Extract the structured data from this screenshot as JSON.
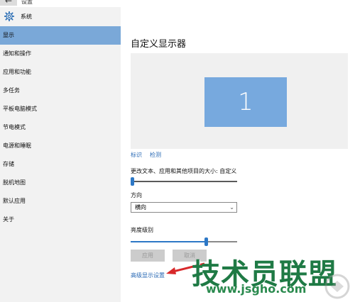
{
  "window": {
    "title": "设置",
    "back_glyph": "←"
  },
  "sidebar": {
    "header": "系统",
    "items": [
      {
        "label": "显示",
        "active": true
      },
      {
        "label": "通知和操作"
      },
      {
        "label": "应用和功能"
      },
      {
        "label": "多任务"
      },
      {
        "label": "平板电脑模式"
      },
      {
        "label": "节电模式"
      },
      {
        "label": "电源和睡眠"
      },
      {
        "label": "存储"
      },
      {
        "label": "脱机地图"
      },
      {
        "label": "默认应用"
      },
      {
        "label": "关于"
      }
    ]
  },
  "main": {
    "title": "自定义显示器",
    "monitor_number": "1",
    "identify_link": "标识",
    "detect_link": "检测",
    "scale_label": "更改文本、应用和其他项目的大小: 自定义",
    "scale_value": 0,
    "orientation_label": "方向",
    "orientation_value": "横向",
    "brightness_label": "亮度级别",
    "brightness_value": 0.72,
    "apply_button": "应用",
    "cancel_button": "取消",
    "advanced_link": "高级显示设置"
  },
  "watermark": {
    "text": "技术员联盟",
    "url": "www.jsgho.com"
  },
  "colors": {
    "accent": "#2d78c6",
    "selected_nav": "#7aa8d8",
    "monitor": "#77a9de",
    "link": "#2a6ab5"
  }
}
